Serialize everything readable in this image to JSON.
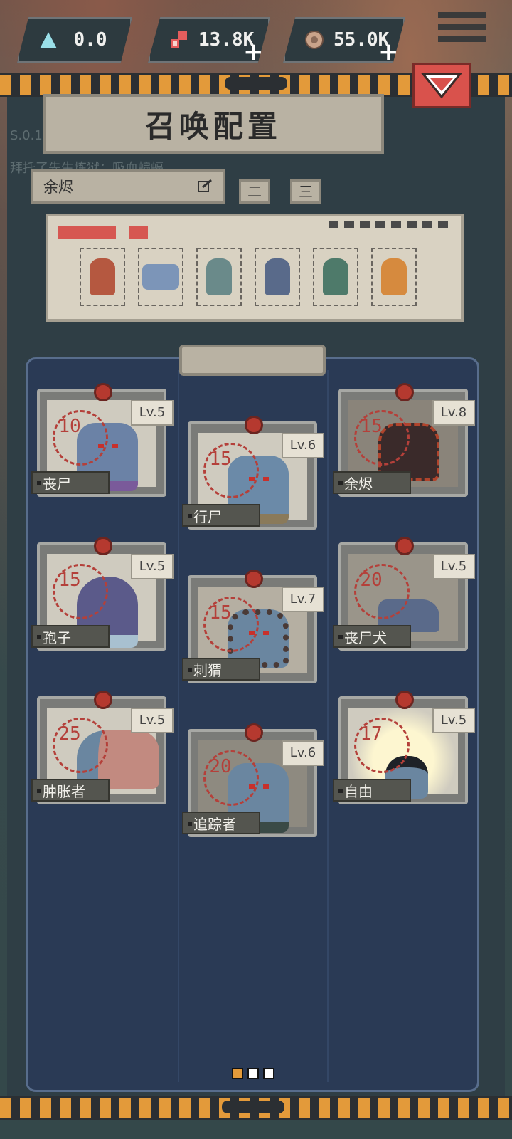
{
  "resources": [
    {
      "name": "crystal",
      "value": "0.0",
      "icon": "crystal-icon",
      "color": "#9adfe8",
      "has_plus": false
    },
    {
      "name": "flesh",
      "value": "13.8K",
      "icon": "flesh-icon",
      "color": "#e45d5d",
      "has_plus": true
    },
    {
      "name": "bone",
      "value": "55.0K",
      "icon": "bone-icon",
      "color": "#c9a38a",
      "has_plus": true
    }
  ],
  "panel": {
    "title": "召唤配置",
    "ghost_text_1": "S.0.1",
    "ghost_text_2": "拜托了先生炼狱：吸血蝙蝠",
    "search_value": "余烬",
    "tab_2": "二",
    "tab_3": "三"
  },
  "team_slots": [
    {
      "icon": "horned-imp-icon",
      "color": "#b55840"
    },
    {
      "icon": "zombie-dog-icon",
      "color": "#7c95b8"
    },
    {
      "icon": "spiky-zombie-icon",
      "color": "#6a8a8a"
    },
    {
      "icon": "hooded-zombie-icon",
      "color": "#596a8a"
    },
    {
      "icon": "green-zombie-icon",
      "color": "#4e7a6a"
    },
    {
      "icon": "hardhat-zombie-icon",
      "color": "#d68a3e"
    }
  ],
  "cards": [
    {
      "name": "丧尸",
      "level": "Lv.5",
      "cost": "10",
      "color": "#6b82a6",
      "accent": "#7a5a9a"
    },
    {
      "name": "行尸",
      "level": "Lv.6",
      "cost": "15",
      "color": "#6b8aa8",
      "accent": "#8a7a5a"
    },
    {
      "name": "余烬",
      "level": "Lv.8",
      "cost": "15",
      "color": "#3a2a2a",
      "accent": "#b0442c"
    },
    {
      "name": "孢子",
      "level": "Lv.5",
      "cost": "15",
      "color": "#5b5a8a",
      "accent": "#a8c0d0"
    },
    {
      "name": "刺猬",
      "level": "Lv.7",
      "cost": "15",
      "color": "#4a3a36",
      "accent": "#6a86a0"
    },
    {
      "name": "丧尸犬",
      "level": "Lv.5",
      "cost": "20",
      "color": "#5a6a8a",
      "accent": "#7a95b8"
    },
    {
      "name": "肿胀者",
      "level": "Lv.5",
      "cost": "25",
      "color": "#c28a80",
      "accent": "#6a86a0"
    },
    {
      "name": "追踪者",
      "level": "Lv.6",
      "cost": "20",
      "color": "#3a4a46",
      "accent": "#6a86a0"
    },
    {
      "name": "自由",
      "level": "Lv.5",
      "cost": "17",
      "color": "#f2e8b8",
      "accent": "#6a86a0"
    }
  ],
  "pager": {
    "count": 3,
    "active": 0,
    "active_color": "#e39a3a"
  }
}
